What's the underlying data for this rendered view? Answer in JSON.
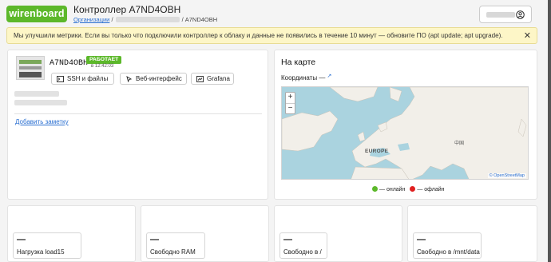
{
  "header": {
    "logo": "wirenboard",
    "title": "Контроллер A7ND4OBH",
    "breadcrumb": {
      "root": "Организации",
      "sep": "/",
      "sep2": "/",
      "current": "A7ND4OBH"
    },
    "user_icon": "user-circle-icon"
  },
  "banner": {
    "text": "Мы улучшили метрики. Если вы только что подключили контроллер к облаку и данные не появились в течение 10 минут — обновите ПО (apt update; apt upgrade).",
    "close": "✕"
  },
  "device": {
    "name": "A7ND4OBH",
    "status": "РАБОТАЕТ",
    "status_time": "в 12:42:03",
    "buttons": {
      "ssh": "SSH и файлы",
      "web": "Веб-интерфейс",
      "grafana": "Grafana"
    },
    "add_note": "Добавить заметку"
  },
  "map": {
    "title": "На карте",
    "coords_label": "Координаты",
    "coords_value": "—",
    "zoom_in": "+",
    "zoom_out": "−",
    "region_label": "EUROPE",
    "cjk_label": "中国",
    "attribution": "© OpenStreetMap",
    "legend": {
      "online": "— онлайн",
      "offline": "— офлайн"
    },
    "colors": {
      "online": "#5cb82a",
      "offline": "#e02020"
    }
  },
  "metrics": [
    {
      "value": "—",
      "label": "Нагрузка load15"
    },
    {
      "value": "—",
      "label": "Свободно RAM"
    },
    {
      "value": "—",
      "label": "Свободно в /"
    },
    {
      "value": "—",
      "label": "Свободно в /mnt/data"
    }
  ],
  "colors": {
    "brand": "#5cb82a",
    "link": "#2a6fd1",
    "banner_bg": "#fdf6c7"
  }
}
